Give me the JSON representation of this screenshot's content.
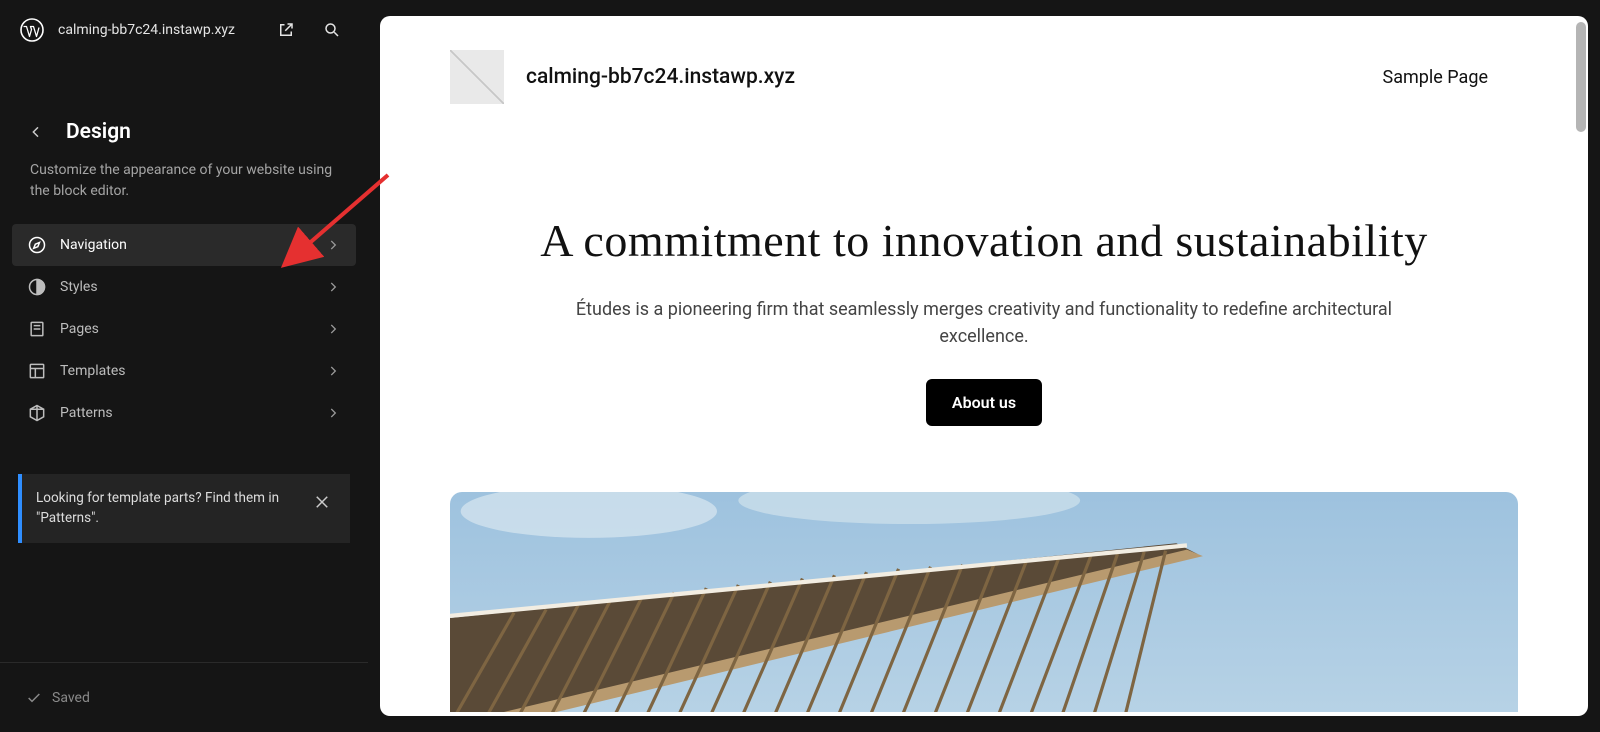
{
  "topbar": {
    "site_url": "calming-bb7c24.instawp.xyz"
  },
  "section": {
    "title": "Design",
    "description": "Customize the appearance of your website using the block editor."
  },
  "menu": [
    {
      "icon": "compass",
      "label": "Navigation",
      "active": true
    },
    {
      "icon": "contrast",
      "label": "Styles",
      "active": false
    },
    {
      "icon": "page",
      "label": "Pages",
      "active": false
    },
    {
      "icon": "layout",
      "label": "Templates",
      "active": false
    },
    {
      "icon": "patterns",
      "label": "Patterns",
      "active": false
    }
  ],
  "notice": {
    "text": "Looking for template parts? Find them in \"Patterns\"."
  },
  "status": {
    "label": "Saved"
  },
  "preview": {
    "site_title": "calming-bb7c24.instawp.xyz",
    "nav_link": "Sample Page",
    "hero_title": "A commitment to innovation and sustainability",
    "hero_body": "Études is a pioneering firm that seamlessly merges creativity and functionality to redefine architectural excellence.",
    "hero_button": "About us"
  },
  "colors": {
    "accent": "#2f8eff",
    "arrow": "#e53030"
  }
}
